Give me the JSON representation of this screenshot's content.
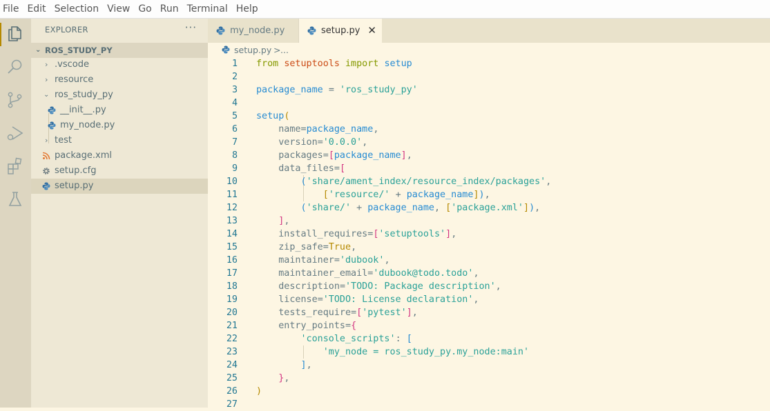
{
  "menu": [
    "File",
    "Edit",
    "Selection",
    "View",
    "Go",
    "Run",
    "Terminal",
    "Help"
  ],
  "activity_bar": [
    "explorer-icon",
    "search-icon",
    "source-control-icon",
    "run-debug-icon",
    "extensions-icon",
    "testing-icon"
  ],
  "colors": {
    "accent": "#b58900",
    "python_icon_blue": "#3572a5",
    "xml_icon": "#e37933"
  },
  "sidebar": {
    "title": "EXPLORER",
    "more": "···",
    "project": "ROS_STUDY_PY",
    "items": [
      {
        "label": ".vscode",
        "type": "folder",
        "expanded": false
      },
      {
        "label": "resource",
        "type": "folder",
        "expanded": false
      },
      {
        "label": "ros_study_py",
        "type": "folder",
        "expanded": true
      },
      {
        "label": "__init__.py",
        "type": "python"
      },
      {
        "label": "my_node.py",
        "type": "python"
      },
      {
        "label": "test",
        "type": "folder",
        "expanded": false
      },
      {
        "label": "package.xml",
        "type": "xml"
      },
      {
        "label": "setup.cfg",
        "type": "config"
      },
      {
        "label": "setup.py",
        "type": "python",
        "selected": true
      }
    ]
  },
  "tabs": [
    {
      "label": "my_node.py",
      "active": false
    },
    {
      "label": "setup.py",
      "active": true,
      "close": "✕"
    }
  ],
  "breadcrumb": {
    "file": "setup.py",
    "separator": ">",
    "more": "..."
  },
  "editor": {
    "line_numbers": [
      "1",
      "2",
      "3",
      "4",
      "5",
      "6",
      "7",
      "8",
      "9",
      "10",
      "11",
      "12",
      "13",
      "14",
      "15",
      "16",
      "17",
      "18",
      "19",
      "20",
      "21",
      "22",
      "23",
      "24",
      "25",
      "26",
      "27"
    ],
    "lines": [
      "from setuptools import setup",
      "",
      "package_name = 'ros_study_py'",
      "",
      "setup(",
      "    name=package_name,",
      "    version='0.0.0',",
      "    packages=[package_name],",
      "    data_files=[",
      "        ('share/ament_index/resource_index/packages',",
      "            ['resource/' + package_name]),",
      "        ('share/' + package_name, ['package.xml']),",
      "    ],",
      "    install_requires=['setuptools'],",
      "    zip_safe=True,",
      "    maintainer='dubook',",
      "    maintainer_email='dubook@todo.todo',",
      "    description='TODO: Package description',",
      "    license='TODO: License declaration',",
      "    tests_require=['pytest'],",
      "    entry_points={",
      "        'console_scripts': [",
      "            'my_node = ros_study_py.my_node:main'",
      "        ],",
      "    },",
      ")",
      ""
    ]
  }
}
